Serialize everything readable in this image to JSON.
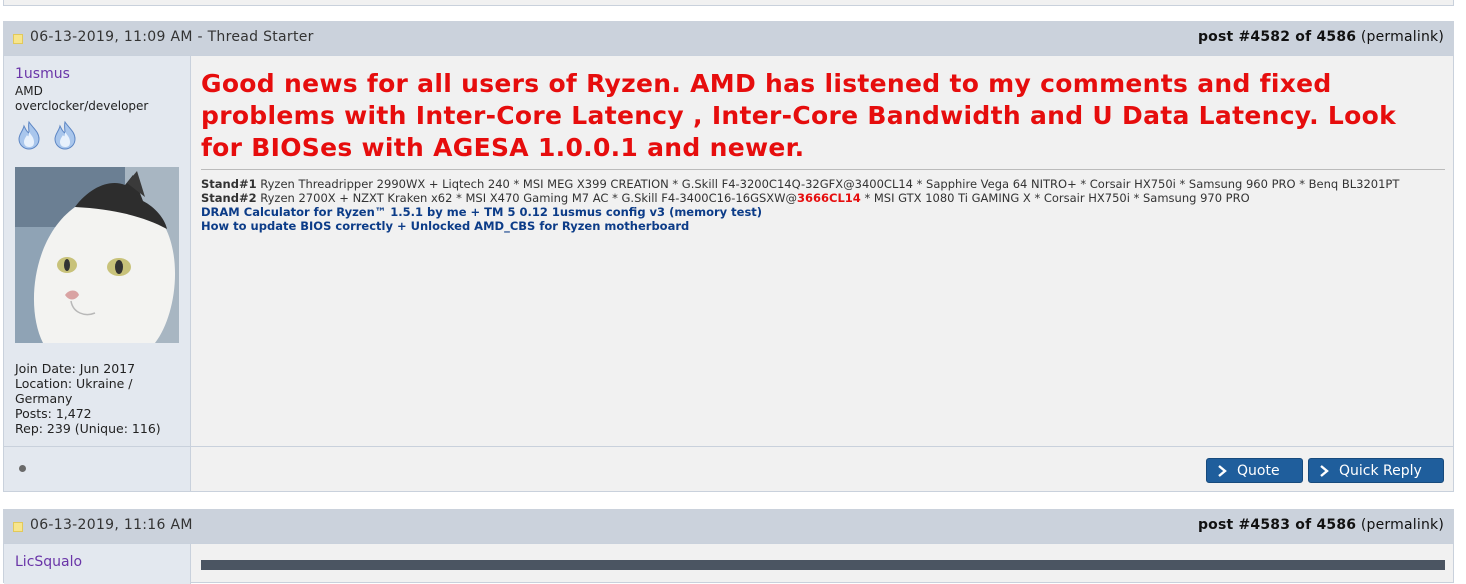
{
  "post1": {
    "date": "06-13-2019, 11:09 AM - Thread Starter",
    "post_label_prefix": "post #4582 of 4586",
    "permalink": "(permalink)",
    "user": {
      "name": "1usmus",
      "title": "AMD overclocker/developer",
      "join_date": "Join Date: Jun 2017",
      "location": "Location: Ukraine / Germany",
      "posts": "Posts: 1,472",
      "rep": "Rep: 239 (Unique: 116)"
    },
    "message": "Good news for all users of Ryzen. AMD has listened to my comments and fixed problems with Inter-Core Latency , Inter-Core Bandwidth and U Data Latency. Look for BIOSes with AGESA 1.0.0.1 and newer.",
    "signature": {
      "stand1_label": "Stand#1",
      "stand1_text": " Ryzen Threadripper 2990WX + Liqtech 240 * MSI MEG X399 CREATION * G.Skill F4-3200C14Q-32GFX@3400CL14 * Sapphire Vega 64 NITRO+ * Corsair HX750i * Samsung 960 PRO * Benq BL3201PT",
      "stand2_label": "Stand#2",
      "stand2_text_a": " Ryzen 2700X + NZXT Kraken x62 * MSI X470 Gaming M7 AC * G.Skill F4-3400C16-16GSXW@",
      "stand2_highlight": "3666CL14",
      "stand2_text_b": " * MSI GTX 1080 Ti GAMING X * Corsair HX750i * Samsung 970 PRO",
      "link1": "DRAM Calculator for Ryzen™ 1.5.1 by me + TM 5 0.12 1usmus config v3 (memory test)",
      "link2": "How to update BIOS correctly + Unlocked AMD_CBS for Ryzen motherboard"
    },
    "buttons": {
      "quote": "Quote",
      "quick_reply": "Quick Reply"
    }
  },
  "post2": {
    "date": "06-13-2019, 11:16 AM",
    "post_label_prefix": "post #4583 of 4586",
    "permalink": "(permalink)",
    "user": {
      "name": "LicSqualo"
    }
  },
  "colors": {
    "header_bg": "#cbd2dc",
    "message_red": "#e60d0d",
    "username_purple": "#6a35a8",
    "button_blue": "#1f5e9c",
    "link_blue": "#0c3c88"
  },
  "icons": [
    "rank-flame-icon",
    "chevron-right-icon",
    "post-status-dot-icon",
    "post-new-icon"
  ]
}
